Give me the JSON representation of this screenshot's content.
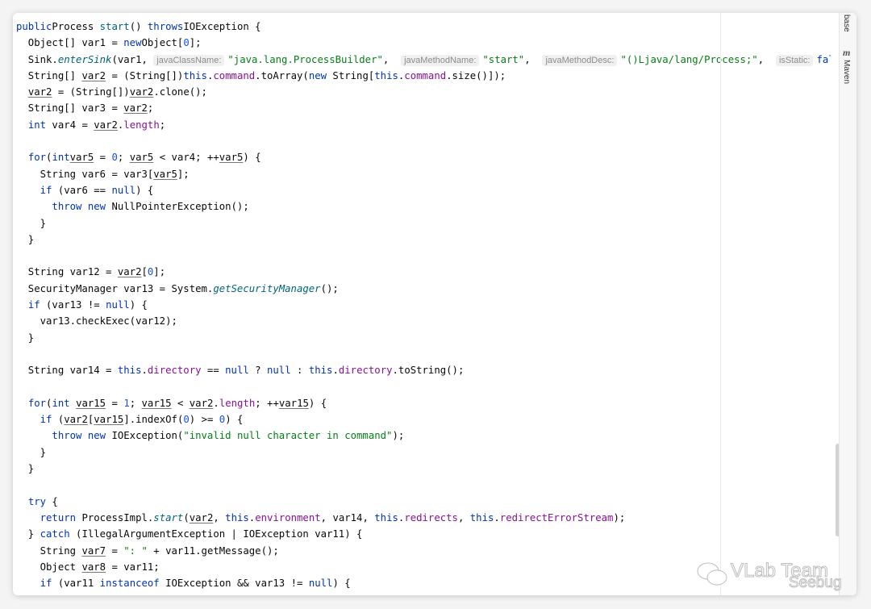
{
  "tool_window": {
    "tabs": [
      "base",
      "Maven"
    ]
  },
  "watermark": {
    "team": "VLab Team",
    "brand": "Seebug"
  },
  "code_lines": [
    [
      [
        "k",
        "public"
      ],
      [
        "",
        "Process "
      ],
      [
        "d",
        "start"
      ],
      [
        "",
        "() "
      ],
      [
        "k",
        "throws"
      ],
      [
        "",
        "IOException {"
      ]
    ],
    [
      [
        "",
        "  Object[] var1 = "
      ],
      [
        "k",
        "new"
      ],
      [
        "",
        "Object["
      ],
      [
        "n",
        "0"
      ],
      [
        "",
        "];"
      ]
    ],
    [
      [
        "",
        "  Sink."
      ],
      [
        "m",
        "enterSink"
      ],
      [
        "",
        "(var1, "
      ],
      [
        "h",
        "javaClassName:"
      ],
      [
        "s",
        "\"java.lang.ProcessBuilder\""
      ],
      [
        "",
        ",  "
      ],
      [
        "h",
        "javaMethodName:"
      ],
      [
        "s",
        "\"start\""
      ],
      [
        "",
        ",  "
      ],
      [
        "h",
        "javaMethodDesc:"
      ],
      [
        "s",
        "\"()Ljava/lang/Process;\""
      ],
      [
        "",
        ",  "
      ],
      [
        "h",
        "isStatic:"
      ],
      [
        "k",
        "false"
      ],
      [
        "",
        ");"
      ]
    ],
    [
      [
        "",
        "  String[] "
      ],
      [
        "u",
        "var2"
      ],
      [
        "",
        " = (String[])"
      ],
      [
        "k",
        "this"
      ],
      [
        "",
        "."
      ],
      [
        "f",
        "command"
      ],
      [
        "",
        ".toArray("
      ],
      [
        "k",
        "new"
      ],
      [
        "",
        " String["
      ],
      [
        "k",
        "this"
      ],
      [
        "",
        "."
      ],
      [
        "f",
        "command"
      ],
      [
        "",
        ".size()]);"
      ]
    ],
    [
      [
        "",
        "  "
      ],
      [
        "u",
        "var2"
      ],
      [
        "",
        " = (String[])"
      ],
      [
        "u",
        "var2"
      ],
      [
        "",
        ".clone();"
      ]
    ],
    [
      [
        "",
        "  String[] var3 = "
      ],
      [
        "u",
        "var2"
      ],
      [
        "",
        ";"
      ]
    ],
    [
      [
        "",
        "  "
      ],
      [
        "k",
        "int"
      ],
      [
        "",
        " var4 = "
      ],
      [
        "u",
        "var2"
      ],
      [
        "",
        "."
      ],
      [
        "f",
        "length"
      ],
      [
        "",
        ";"
      ]
    ],
    [],
    [
      [
        "",
        "  "
      ],
      [
        "k",
        "for"
      ],
      [
        "",
        "("
      ],
      [
        "k",
        "int"
      ],
      [
        "",
        "",
        " "
      ],
      [
        "u",
        "var5"
      ],
      [
        "",
        " = "
      ],
      [
        "n",
        "0"
      ],
      [
        "",
        "; "
      ],
      [
        "u",
        "var5"
      ],
      [
        "",
        " < var4; ++"
      ],
      [
        "u",
        "var5"
      ],
      [
        "",
        ") {"
      ]
    ],
    [
      [
        "",
        "    String var6 = var3["
      ],
      [
        "u",
        "var5"
      ],
      [
        "",
        "];"
      ]
    ],
    [
      [
        "",
        "    "
      ],
      [
        "k",
        "if"
      ],
      [
        "",
        " (var6 == "
      ],
      [
        "k",
        "null"
      ],
      [
        "",
        ") {"
      ]
    ],
    [
      [
        "",
        "      "
      ],
      [
        "k",
        "throw new"
      ],
      [
        "",
        " NullPointerException();"
      ]
    ],
    [
      [
        "",
        "    }"
      ]
    ],
    [
      [
        "",
        "  }"
      ]
    ],
    [],
    [
      [
        "",
        "  String var12 = "
      ],
      [
        "u",
        "var2"
      ],
      [
        "",
        "["
      ],
      [
        "n",
        "0"
      ],
      [
        "",
        "];"
      ]
    ],
    [
      [
        "",
        "  SecurityManager var13 = System."
      ],
      [
        "m",
        "getSecurityManager"
      ],
      [
        "",
        "();"
      ]
    ],
    [
      [
        "",
        "  "
      ],
      [
        "k",
        "if"
      ],
      [
        "",
        " (var13 != "
      ],
      [
        "k",
        "null"
      ],
      [
        "",
        ") {"
      ]
    ],
    [
      [
        "",
        "    var13.checkExec(var12);"
      ]
    ],
    [
      [
        "",
        "  }"
      ]
    ],
    [],
    [
      [
        "",
        "  String var14 = "
      ],
      [
        "k",
        "this"
      ],
      [
        "",
        "."
      ],
      [
        "f",
        "directory"
      ],
      [
        "",
        " == "
      ],
      [
        "k",
        "null"
      ],
      [
        "",
        " ? "
      ],
      [
        "k",
        "null"
      ],
      [
        "",
        " : "
      ],
      [
        "k",
        "this"
      ],
      [
        "",
        "."
      ],
      [
        "f",
        "directory"
      ],
      [
        "",
        ".toString();"
      ]
    ],
    [],
    [
      [
        "",
        "  "
      ],
      [
        "k",
        "for"
      ],
      [
        "",
        "("
      ],
      [
        "k",
        "int"
      ],
      [
        "",
        " "
      ],
      [
        "u",
        "var15"
      ],
      [
        "",
        " = "
      ],
      [
        "n",
        "1"
      ],
      [
        "",
        "; "
      ],
      [
        "u",
        "var15"
      ],
      [
        "",
        " < "
      ],
      [
        "u",
        "var2"
      ],
      [
        "",
        "."
      ],
      [
        "f",
        "length"
      ],
      [
        "",
        "; ++"
      ],
      [
        "u",
        "var15"
      ],
      [
        "",
        ") {"
      ]
    ],
    [
      [
        "",
        "    "
      ],
      [
        "k",
        "if"
      ],
      [
        "",
        " ("
      ],
      [
        "u",
        "var2"
      ],
      [
        "",
        "["
      ],
      [
        "u",
        "var15"
      ],
      [
        "",
        "].indexOf("
      ],
      [
        "n",
        "0"
      ],
      [
        "",
        ") >= "
      ],
      [
        "n",
        "0"
      ],
      [
        "",
        ") {"
      ]
    ],
    [
      [
        "",
        "      "
      ],
      [
        "k",
        "throw new"
      ],
      [
        "",
        " IOException("
      ],
      [
        "s",
        "\"invalid null character in command\""
      ],
      [
        "",
        ");"
      ]
    ],
    [
      [
        "",
        "    }"
      ]
    ],
    [
      [
        "",
        "  }"
      ]
    ],
    [],
    [
      [
        "",
        "  "
      ],
      [
        "k",
        "try"
      ],
      [
        "",
        " {"
      ]
    ],
    [
      [
        "",
        "    "
      ],
      [
        "k",
        "return"
      ],
      [
        "",
        " ProcessImpl."
      ],
      [
        "m",
        "start"
      ],
      [
        "",
        "("
      ],
      [
        "u",
        "var2"
      ],
      [
        "",
        ", "
      ],
      [
        "k",
        "this"
      ],
      [
        "",
        "."
      ],
      [
        "f",
        "environment"
      ],
      [
        "",
        ", var14, "
      ],
      [
        "k",
        "this"
      ],
      [
        "",
        "."
      ],
      [
        "f",
        "redirects"
      ],
      [
        "",
        ", "
      ],
      [
        "k",
        "this"
      ],
      [
        "",
        "."
      ],
      [
        "f",
        "redirectErrorStream"
      ],
      [
        "",
        ");"
      ]
    ],
    [
      [
        "",
        "  } "
      ],
      [
        "k",
        "catch"
      ],
      [
        "",
        " (IllegalArgumentException | IOException var11) {"
      ]
    ],
    [
      [
        "",
        "    String "
      ],
      [
        "u",
        "var7"
      ],
      [
        "",
        " = "
      ],
      [
        "s",
        "\": \""
      ],
      [
        "",
        " + var11.getMessage();"
      ]
    ],
    [
      [
        "",
        "    Object "
      ],
      [
        "u",
        "var8"
      ],
      [
        "",
        " = var11;"
      ]
    ],
    [
      [
        "",
        "    "
      ],
      [
        "k",
        "if"
      ],
      [
        "",
        " (var11 "
      ],
      [
        "k",
        "instanceof"
      ],
      [
        "",
        " IOException && var13 != "
      ],
      [
        "k",
        "null"
      ],
      [
        "",
        ") {"
      ]
    ]
  ]
}
